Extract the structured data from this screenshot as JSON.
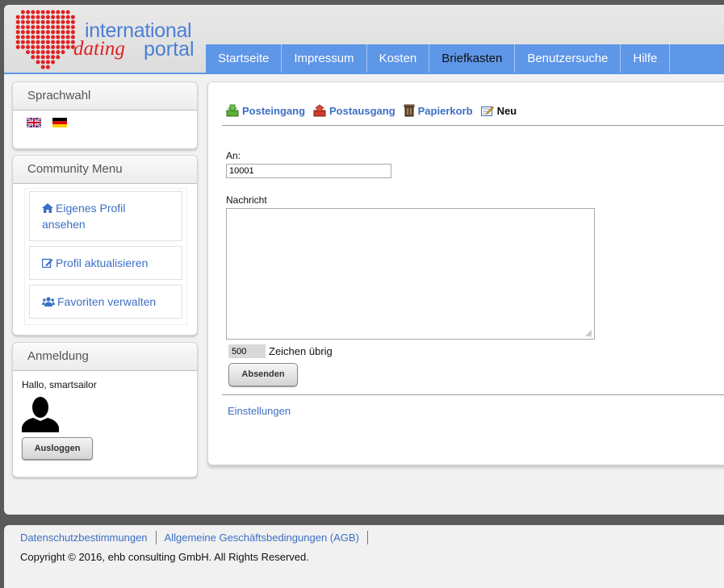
{
  "logo": {
    "line1": "international",
    "line2a": "dating",
    "line2b": "portal"
  },
  "nav": {
    "items": [
      {
        "label": "Startseite"
      },
      {
        "label": "Impressum"
      },
      {
        "label": "Kosten"
      },
      {
        "label": "Briefkasten",
        "active": true
      },
      {
        "label": "Benutzersuche"
      },
      {
        "label": "Hilfe"
      }
    ]
  },
  "sidebar": {
    "language": {
      "title": "Sprachwahl",
      "flags": [
        "uk-flag-icon",
        "german-flag-icon"
      ]
    },
    "community": {
      "title": "Community Menu",
      "links": [
        {
          "label": "Eigenes Profil ansehen",
          "icon": "home-icon"
        },
        {
          "label": "Profil aktualisieren",
          "icon": "edit-icon"
        },
        {
          "label": "Favoriten verwalten",
          "icon": "users-icon"
        }
      ]
    },
    "login": {
      "title": "Anmeldung",
      "greeting": "Hallo, smartsailor",
      "logout_label": "Ausloggen"
    }
  },
  "mailbox": {
    "tabs": [
      {
        "label": "Posteingang",
        "icon": "inbox-icon"
      },
      {
        "label": "Postausgang",
        "icon": "outbox-icon"
      },
      {
        "label": "Papierkorb",
        "icon": "trash-icon"
      },
      {
        "label": "Neu",
        "icon": "compose-icon",
        "active": true
      }
    ]
  },
  "compose": {
    "to_label": "An:",
    "to_value": "10001",
    "message_label": "Nachricht",
    "message_value": "",
    "chars_left": "500",
    "chars_left_label": "Zeichen übrig",
    "send_label": "Absenden",
    "settings_label": "Einstellungen"
  },
  "footer": {
    "links": [
      "Datenschutzbestimmungen",
      "Allgemeine Geschäftsbedingungen (AGB)"
    ],
    "copyright": "Copyright © 2016, ehb consulting GmbH. All Rights Reserved."
  },
  "colors": {
    "nav_blue": "#5e96e8",
    "link_blue": "#3c6fc4",
    "logo_red": "#e02020"
  }
}
